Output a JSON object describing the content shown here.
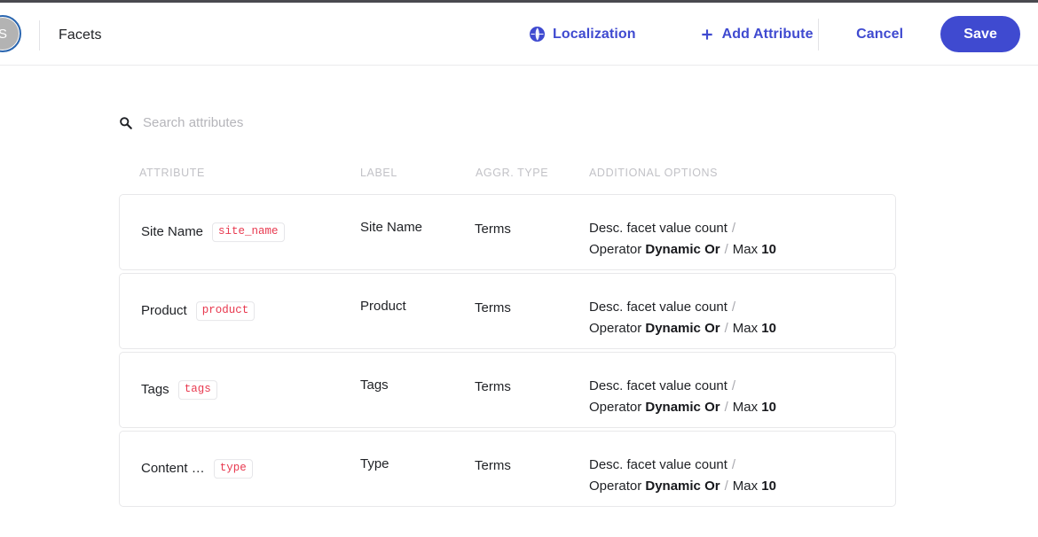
{
  "header": {
    "avatar_label": "S",
    "title": "Facets",
    "localization_label": "Localization",
    "localization_icon": "globe-icon",
    "add_attribute_label": "Add Attribute",
    "add_attribute_icon": "plus-icon",
    "cancel_label": "Cancel",
    "save_label": "Save",
    "accent_color": "#3f4ad0",
    "avatar_ring_color": "#2a66b0"
  },
  "search": {
    "icon": "search-icon",
    "placeholder": "Search attributes",
    "value": ""
  },
  "table": {
    "columns": [
      {
        "key": "attribute",
        "label": "ATTRIBUTE"
      },
      {
        "key": "label",
        "label": "LABEL"
      },
      {
        "key": "aggr_type",
        "label": "AGGR. TYPE"
      },
      {
        "key": "additional_options",
        "label": "ADDITIONAL OPTIONS"
      }
    ],
    "rows": [
      {
        "attribute": "Site Name",
        "code": "site_name",
        "label": "Site Name",
        "aggr_type": "Terms",
        "sort": "Desc. facet value count",
        "operator_label": "Operator",
        "operator_value": "Dynamic Or",
        "max_label": "Max",
        "max_value": "10",
        "separator": "/"
      },
      {
        "attribute": "Product",
        "code": "product",
        "label": "Product",
        "aggr_type": "Terms",
        "sort": "Desc. facet value count",
        "operator_label": "Operator",
        "operator_value": "Dynamic Or",
        "max_label": "Max",
        "max_value": "10",
        "separator": "/"
      },
      {
        "attribute": "Tags",
        "code": "tags",
        "label": "Tags",
        "aggr_type": "Terms",
        "sort": "Desc. facet value count",
        "operator_label": "Operator",
        "operator_value": "Dynamic Or",
        "max_label": "Max",
        "max_value": "10",
        "separator": "/"
      },
      {
        "attribute": "Content …",
        "code": "type",
        "label": "Type",
        "aggr_type": "Terms",
        "sort": "Desc. facet value count",
        "operator_label": "Operator",
        "operator_value": "Dynamic Or",
        "max_label": "Max",
        "max_value": "10",
        "separator": "/"
      }
    ]
  },
  "colors": {
    "code_badge_text": "#e8394f",
    "card_border": "#e8e8ea",
    "column_header_text": "#c2c2c7"
  }
}
